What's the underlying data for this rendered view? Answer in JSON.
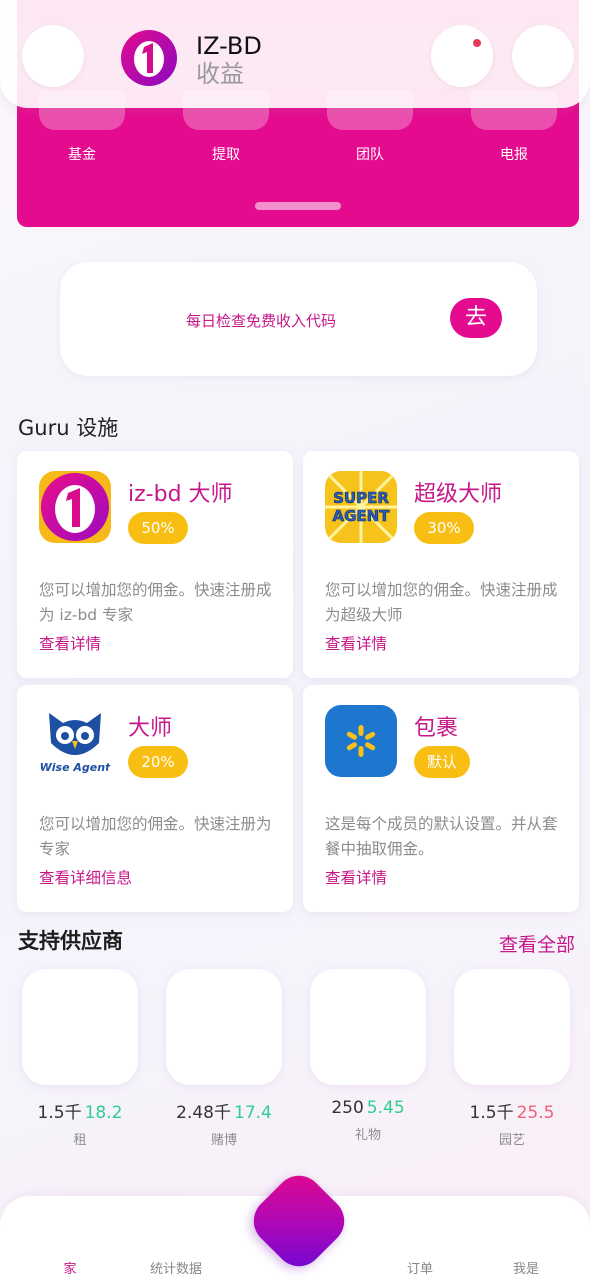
{
  "header": {
    "title": "IZ-BD",
    "subtitle": "收益"
  },
  "quick_actions": [
    {
      "label": "基金"
    },
    {
      "label": "提取"
    },
    {
      "label": "团队"
    },
    {
      "label": "电报"
    }
  ],
  "daily_card": {
    "text": "每日检查免费收入代码",
    "button": "去"
  },
  "guru_section": {
    "title": "Guru 设施",
    "cards": [
      {
        "name": "iz-bd 大师",
        "badge": "50%",
        "description": "您可以增加您的佣金。快速注册成为 iz-bd 专家",
        "link": "查看详情",
        "icon": "iz-bd-logo-icon"
      },
      {
        "name": "超级大师",
        "badge": "30%",
        "description": "您可以增加您的佣金。快速注册成为超级大师",
        "link": "查看详情",
        "icon": "super-agent-icon",
        "icon_text": "SUPER AGENT"
      },
      {
        "name": "大师",
        "badge": "20%",
        "description": "您可以增加您的佣金。快速注册为专家",
        "link": "查看详细信息",
        "icon": "wise-agent-owl-icon",
        "icon_text": "Wise Agent"
      },
      {
        "name": "包裹",
        "badge": "默认",
        "description": "这是每个成员的默认设置。并从套餐中抽取佣金。",
        "link": "查看详情",
        "icon": "spark-icon"
      }
    ]
  },
  "suppliers": {
    "title": "支持供应商",
    "view_all": "查看全部",
    "items": [
      {
        "value": "1.5千",
        "change": "18.2",
        "trend": "up",
        "label": "租"
      },
      {
        "value": "2.48千",
        "change": "17.4",
        "trend": "up",
        "label": "赌博"
      },
      {
        "value": "250",
        "change": "5.45",
        "trend": "up",
        "label": "礼物"
      },
      {
        "value": "1.5千",
        "change": "25.5",
        "trend": "down",
        "label": "园艺"
      }
    ]
  },
  "bottom_nav": {
    "home": "家",
    "stats": "统计数据",
    "orders": "订单",
    "me": "我是"
  },
  "colors": {
    "brand_pink": "#e40b8e",
    "badge_yellow": "#f9be12",
    "up_green": "#2fd08f",
    "down_red": "#f0607b"
  }
}
